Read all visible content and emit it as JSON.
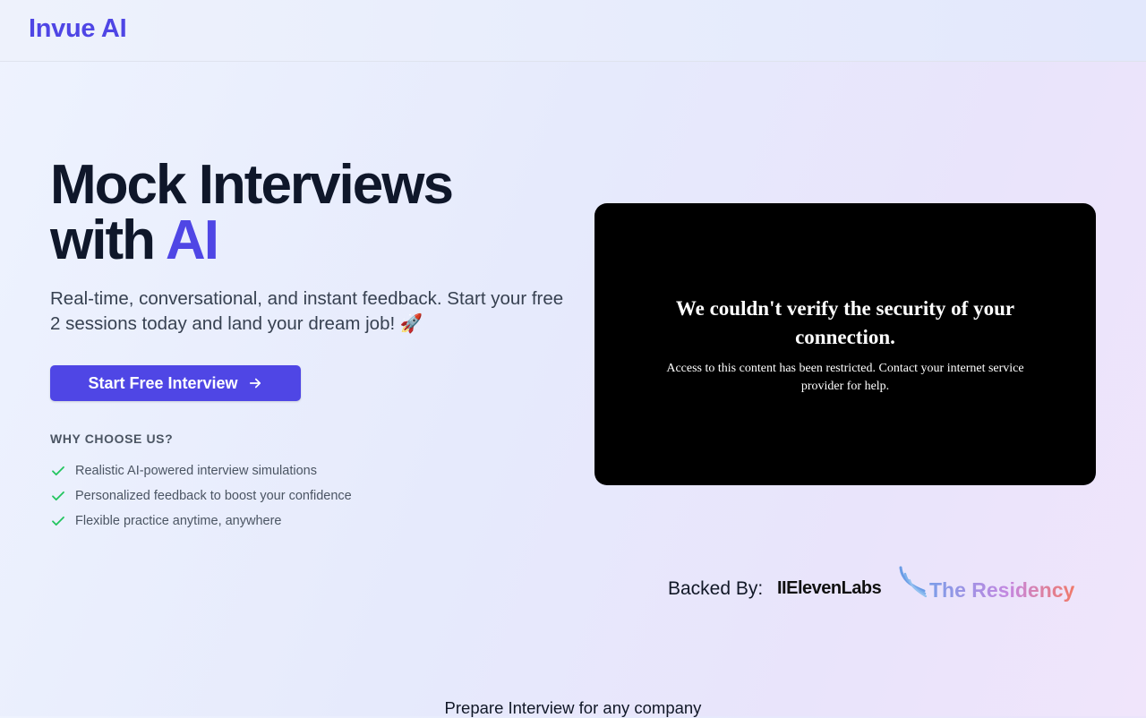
{
  "brand": {
    "name": "Invue AI",
    "accent_color": "#4f46e5"
  },
  "hero": {
    "title_line1": "Mock Interviews",
    "title_with": "with",
    "title_accent": "AI",
    "subtitle": "Real-time, conversational, and instant feedback. Start your free 2 sessions today and land your dream job! 🚀",
    "cta_label": "Start Free Interview",
    "cta_icon": "arrow-right-icon"
  },
  "why": {
    "heading": "WHY CHOOSE US?",
    "check_icon": "check-icon",
    "check_color": "#22c55e",
    "items": [
      "Realistic AI-powered interview simulations",
      "Personalized feedback to boost your confidence",
      "Flexible practice anytime, anywhere"
    ]
  },
  "video_panel": {
    "title": "We couldn't verify the security of your connection.",
    "body": "Access to this content has been restricted. Contact your internet service provider for help."
  },
  "backers": {
    "label": "Backed By:",
    "items": [
      "IIElevenLabs",
      "The Residency"
    ]
  },
  "footer_teaser": "Prepare Interview for any company"
}
